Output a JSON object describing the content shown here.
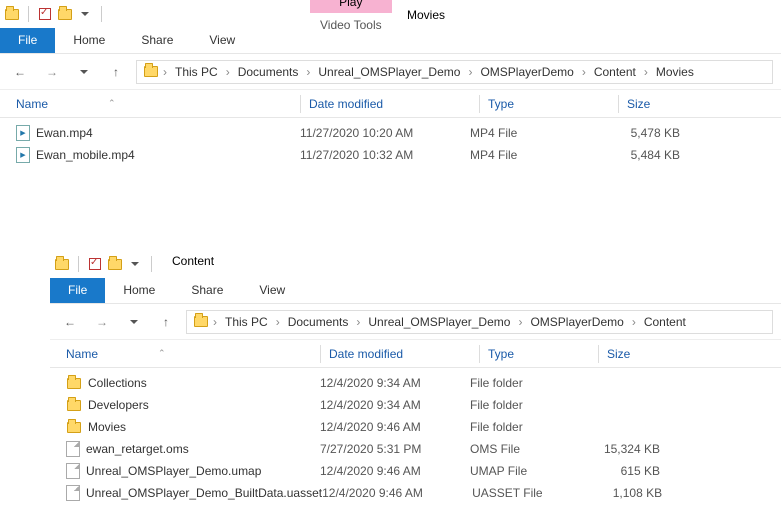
{
  "top": {
    "context_play": "Play",
    "context_group": "Video Tools",
    "title": "Movies",
    "tab_file": "File",
    "tab_home": "Home",
    "tab_share": "Share",
    "tab_view": "View",
    "breadcrumb": {
      "seg0": "This PC",
      "seg1": "Documents",
      "seg2": "Unreal_OMSPlayer_Demo",
      "seg3": "OMSPlayerDemo",
      "seg4": "Content",
      "seg5": "Movies"
    },
    "col_name": "Name",
    "col_date": "Date modified",
    "col_type": "Type",
    "col_size": "Size",
    "rows": {
      "r0": {
        "name": "Ewan.mp4",
        "date": "11/27/2020 10:20 AM",
        "type": "MP4 File",
        "size": "5,478 KB"
      },
      "r1": {
        "name": "Ewan_mobile.mp4",
        "date": "11/27/2020 10:32 AM",
        "type": "MP4 File",
        "size": "5,484 KB"
      }
    }
  },
  "bot": {
    "title": "Content",
    "tab_file": "File",
    "tab_home": "Home",
    "tab_share": "Share",
    "tab_view": "View",
    "breadcrumb": {
      "seg0": "This PC",
      "seg1": "Documents",
      "seg2": "Unreal_OMSPlayer_Demo",
      "seg3": "OMSPlayerDemo",
      "seg4": "Content"
    },
    "col_name": "Name",
    "col_date": "Date modified",
    "col_type": "Type",
    "col_size": "Size",
    "rows": {
      "r0": {
        "name": "Collections",
        "date": "12/4/2020 9:34 AM",
        "type": "File folder",
        "size": ""
      },
      "r1": {
        "name": "Developers",
        "date": "12/4/2020 9:34 AM",
        "type": "File folder",
        "size": ""
      },
      "r2": {
        "name": "Movies",
        "date": "12/4/2020 9:46 AM",
        "type": "File folder",
        "size": ""
      },
      "r3": {
        "name": "ewan_retarget.oms",
        "date": "7/27/2020 5:31 PM",
        "type": "OMS File",
        "size": "15,324 KB"
      },
      "r4": {
        "name": "Unreal_OMSPlayer_Demo.umap",
        "date": "12/4/2020 9:46 AM",
        "type": "UMAP File",
        "size": "615 KB"
      },
      "r5": {
        "name": "Unreal_OMSPlayer_Demo_BuiltData.uasset",
        "date": "12/4/2020 9:46 AM",
        "type": "UASSET File",
        "size": "1,108 KB"
      }
    }
  }
}
